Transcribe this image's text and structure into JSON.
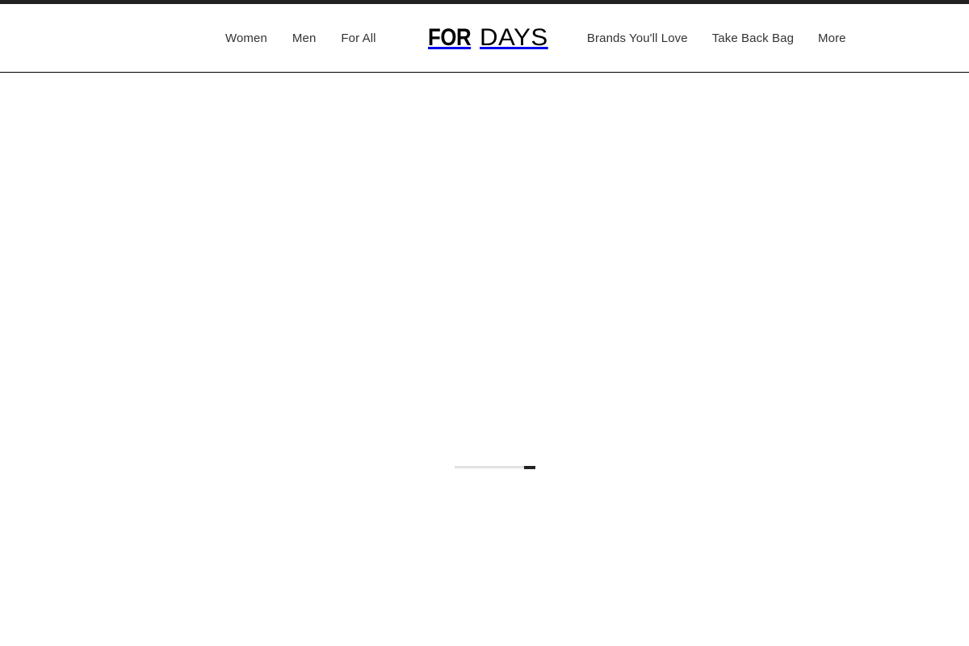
{
  "page": {
    "title": "For Days",
    "state": "loading",
    "background_color": "#ffffff"
  },
  "top_strip": {
    "color": "#222222"
  },
  "header": {
    "border_color": "#000000",
    "brand": {
      "name": "FOR DAYS",
      "part_one": "FOR",
      "part_two": "DAYS",
      "color": "#000000"
    },
    "nav_left": [
      {
        "label": "Women"
      },
      {
        "label": "Men"
      },
      {
        "label": "For All"
      }
    ],
    "nav_right": [
      {
        "label": "Brands You'll Love"
      },
      {
        "label": "Take Back Bag"
      },
      {
        "label": "More"
      }
    ],
    "link_color": "#333333"
  },
  "main": {
    "loader": {
      "track_color": "#e2e2e2",
      "bar_color": "#222222",
      "progress_percent": 86
    }
  }
}
